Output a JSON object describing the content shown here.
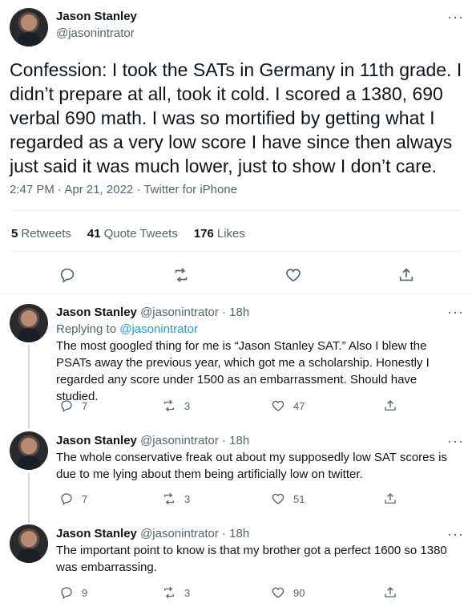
{
  "main": {
    "name": "Jason Stanley",
    "handle": "@jasonintrator",
    "text": "Confession: I took the SATs in Germany in 11th grade. I didn’t prepare at all, took it cold. I scored a 1380, 690 verbal 690 math. I was so mortified by getting what I regarded as a very low score I have since then always just said it was much lower, just to show I don’t care.",
    "time": "2:47 PM · Apr 21, 2022 · Twitter for iPhone",
    "retweets_count": "5",
    "retweets_label": "Retweets",
    "quotes_count": "41",
    "quotes_label": "Quote Tweets",
    "likes_count": "176",
    "likes_label": "Likes"
  },
  "replies": [
    {
      "name": "Jason Stanley",
      "meta": "@jasonintrator · 18h",
      "replying_prefix": "Replying to",
      "replying_handle": "@jasonintrator",
      "text": "The most googled thing for me is “Jason Stanley SAT.” Also I blew the PSATs away the previous year, which got me a scholarship. Honestly I regarded any score under 1500 as an embarrassment. Should have studied.",
      "replies": "7",
      "retweets": "3",
      "likes": "47"
    },
    {
      "name": "Jason Stanley",
      "meta": "@jasonintrator · 18h",
      "text": "The whole conservative freak out about my supposedly low SAT scores is due to me lying about them being artificially low on twitter.",
      "replies": "7",
      "retweets": "3",
      "likes": "51"
    },
    {
      "name": "Jason Stanley",
      "meta": "@jasonintrator · 18h",
      "text": "The important point to know is that my brother got a perfect 1600 so 1380 was embarrassing.",
      "replies": "9",
      "retweets": "3",
      "likes": "90"
    }
  ],
  "more_glyph": "···",
  "icons": [
    "reply-icon",
    "retweet-icon",
    "like-icon",
    "share-icon",
    "more-icon"
  ],
  "colors": {
    "link": "#1d9bf0",
    "muted": "#536471",
    "text": "#0f1419"
  }
}
